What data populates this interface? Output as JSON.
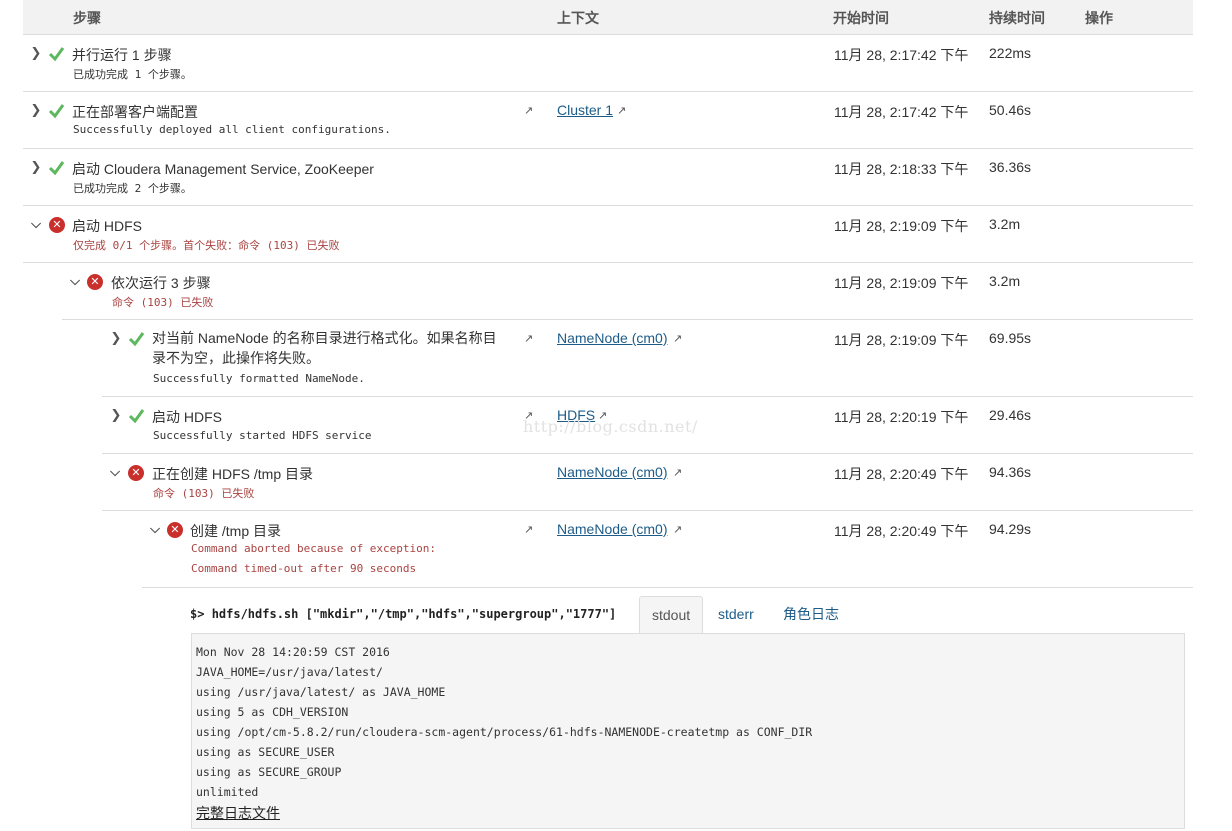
{
  "header": {
    "step": "步骤",
    "context": "上下文",
    "start_time": "开始时间",
    "duration": "持续时间",
    "actions": "操作"
  },
  "steps": [
    {
      "title": "并行运行 1 步骤",
      "sub": "已成功完成 1 个步骤。",
      "status": "success",
      "expanded": false,
      "time": "11月 28, 2:17:42 下午",
      "duration": "222ms",
      "context": ""
    },
    {
      "title": "正在部署客户端配置",
      "sub": "Successfully deployed all client configurations.",
      "status": "success",
      "expanded": false,
      "time": "11月 28, 2:17:42 下午",
      "duration": "50.46s",
      "context": "Cluster 1"
    },
    {
      "title": "启动 Cloudera Management Service, ZooKeeper",
      "sub": "已成功完成 2 个步骤。",
      "status": "success",
      "expanded": false,
      "time": "11月 28, 2:18:33 下午",
      "duration": "36.36s",
      "context": ""
    },
    {
      "title": "启动 HDFS",
      "sub": "仅完成 0/1 个步骤。首个失败：命令 (103) 已失败",
      "status": "failed",
      "expanded": true,
      "time": "11月 28, 2:19:09 下午",
      "duration": "3.2m",
      "context": ""
    },
    {
      "title": "依次运行 3 步骤",
      "sub": "命令 (103) 已失败",
      "status": "failed",
      "expanded": true,
      "time": "11月 28, 2:19:09 下午",
      "duration": "3.2m",
      "context": ""
    },
    {
      "title": "对当前 NameNode 的名称目录进行格式化。如果名称目录不为空，此操作将失败。",
      "sub": "Successfully formatted NameNode.",
      "status": "success",
      "expanded": false,
      "time": "11月 28, 2:19:09 下午",
      "duration": "69.95s",
      "context": "NameNode (cm0)"
    },
    {
      "title": "启动 HDFS",
      "sub": "Successfully started HDFS service",
      "status": "success",
      "expanded": false,
      "time": "11月 28, 2:20:19 下午",
      "duration": "29.46s",
      "context": "HDFS"
    },
    {
      "title": "正在创建 HDFS /tmp 目录",
      "sub": "命令 (103) 已失败",
      "status": "failed",
      "expanded": true,
      "time": "11月 28, 2:20:49 下午",
      "duration": "94.36s",
      "context": "NameNode (cm0)"
    },
    {
      "title": "创建 /tmp 目录",
      "sub": "Command aborted because of exception:",
      "sub2": "Command timed-out after 90 seconds",
      "status": "failed",
      "expanded": true,
      "time": "11月 28, 2:20:49 下午",
      "duration": "94.29s",
      "context": "NameNode (cm0)"
    }
  ],
  "command": {
    "prompt": "$>",
    "text": "hdfs/hdfs.sh [\"mkdir\",\"/tmp\",\"hdfs\",\"supergroup\",\"1777\"]"
  },
  "tabs": [
    {
      "label": "stdout",
      "active": true
    },
    {
      "label": "stderr",
      "active": false
    },
    {
      "label": "角色日志",
      "active": false
    }
  ],
  "console": {
    "lines": [
      "Mon Nov 28 14:20:59 CST 2016",
      "JAVA_HOME=/usr/java/latest/",
      "using /usr/java/latest/ as JAVA_HOME",
      "using 5 as CDH_VERSION",
      "using /opt/cm-5.8.2/run/cloudera-scm-agent/process/61-hdfs-NAMENODE-createtmp as CONF_DIR",
      "using  as SECURE_USER",
      "using  as SECURE_GROUP",
      "unlimited"
    ],
    "full_log_link": "完整日志文件"
  },
  "watermark": "http://blog.csdn.net/",
  "icons": {
    "collapsed": "chevron-right-icon",
    "expanded": "chevron-down-icon",
    "success": "check-icon",
    "failed": "error-circle-icon",
    "external": "external-link-icon"
  },
  "colors": {
    "success": "#5cb85c",
    "failed": "#c9302c",
    "error_text": "#a94442",
    "link": "#1d5c88"
  }
}
